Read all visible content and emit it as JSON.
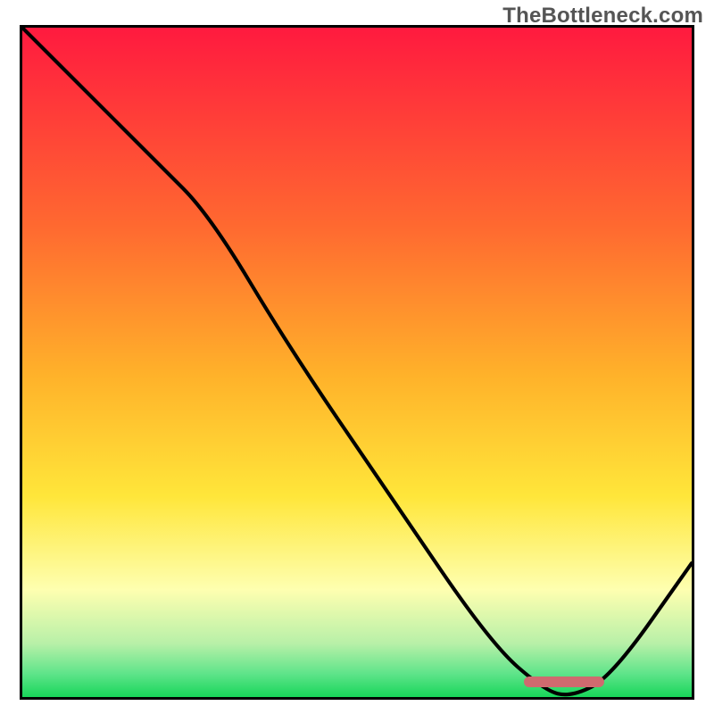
{
  "watermark": "TheBottleneck.com",
  "colors": {
    "red": "#ff1a3f",
    "orange": "#ff8a2a",
    "yellow": "#ffe63a",
    "paleYellow": "#feffb0",
    "paleGreen": "#9eeaa0",
    "green": "#18d65a",
    "curve": "#000000",
    "marker": "#cf6a6f",
    "border": "#000000"
  },
  "gradient_stops": [
    {
      "offset": 0.0,
      "color": "#ff1a3f"
    },
    {
      "offset": 0.3,
      "color": "#ff6a30"
    },
    {
      "offset": 0.52,
      "color": "#ffb22a"
    },
    {
      "offset": 0.7,
      "color": "#ffe63a"
    },
    {
      "offset": 0.84,
      "color": "#feffb0"
    },
    {
      "offset": 0.92,
      "color": "#b8f0a8"
    },
    {
      "offset": 0.965,
      "color": "#5fe48a"
    },
    {
      "offset": 1.0,
      "color": "#18d65a"
    }
  ],
  "chart_data": {
    "type": "line",
    "title": "",
    "xlabel": "",
    "ylabel": "",
    "xlim": [
      0,
      100
    ],
    "ylim": [
      0,
      100
    ],
    "grid": false,
    "legend": false,
    "series": [
      {
        "name": "bottleneck-curve",
        "x": [
          0,
          10,
          20,
          28,
          40,
          55,
          70,
          78,
          82,
          88,
          100
        ],
        "y": [
          100,
          90,
          80,
          72,
          52,
          30,
          8,
          1,
          0,
          3,
          20
        ]
      }
    ],
    "annotations": [
      {
        "name": "optimal-marker",
        "type": "hbar",
        "x_start": 75,
        "x_end": 87,
        "y": 1.5,
        "color": "#cf6a6f"
      }
    ]
  }
}
